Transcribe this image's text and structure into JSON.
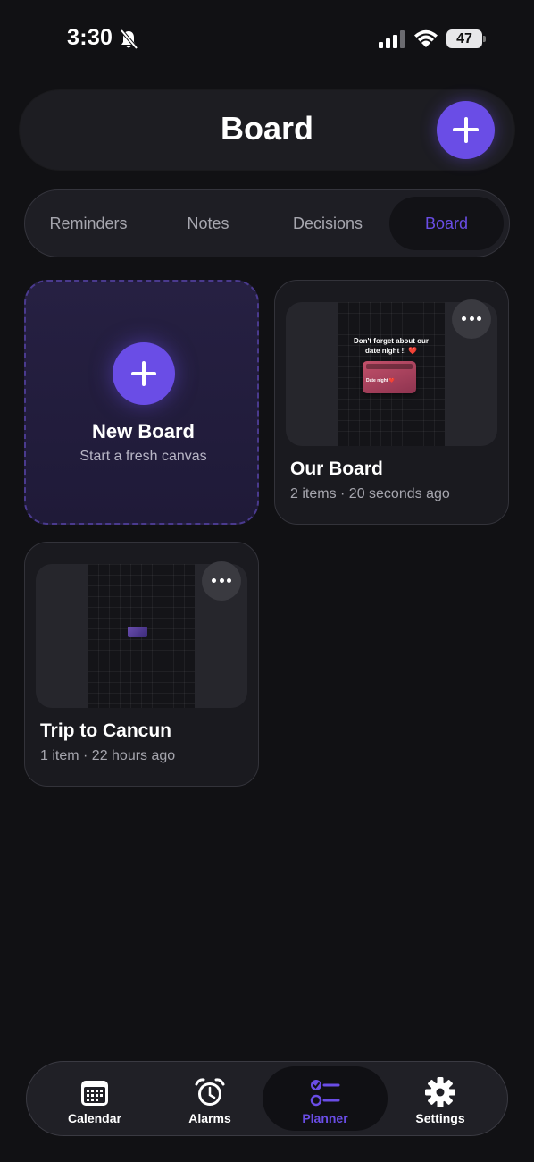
{
  "status_bar": {
    "time": "3:30",
    "battery": "47",
    "battery_percent": 47
  },
  "header": {
    "title": "Board",
    "add_icon": "plus-icon"
  },
  "tabs": [
    {
      "label": "Reminders",
      "active": false
    },
    {
      "label": "Notes",
      "active": false
    },
    {
      "label": "Decisions",
      "active": false
    },
    {
      "label": "Board",
      "active": true
    }
  ],
  "new_board": {
    "title": "New Board",
    "subtitle": "Start a fresh canvas"
  },
  "boards": [
    {
      "title": "Our Board",
      "meta": "2 items · 20 seconds ago",
      "preview_note": "Don't forget about our date night !! ❤️",
      "preview_card_label": "Date night ❤️"
    },
    {
      "title": "Trip to Cancun",
      "meta": "1 item · 22 hours ago"
    }
  ],
  "bottom_nav": [
    {
      "label": "Calendar",
      "icon": "calendar-icon",
      "active": false
    },
    {
      "label": "Alarms",
      "icon": "alarm-clock-icon",
      "active": false
    },
    {
      "label": "Planner",
      "icon": "checklist-icon",
      "active": true
    },
    {
      "label": "Settings",
      "icon": "gear-icon",
      "active": false
    }
  ],
  "colors": {
    "accent": "#6a4de6",
    "background": "#111114",
    "surface": "#1d1d22"
  }
}
